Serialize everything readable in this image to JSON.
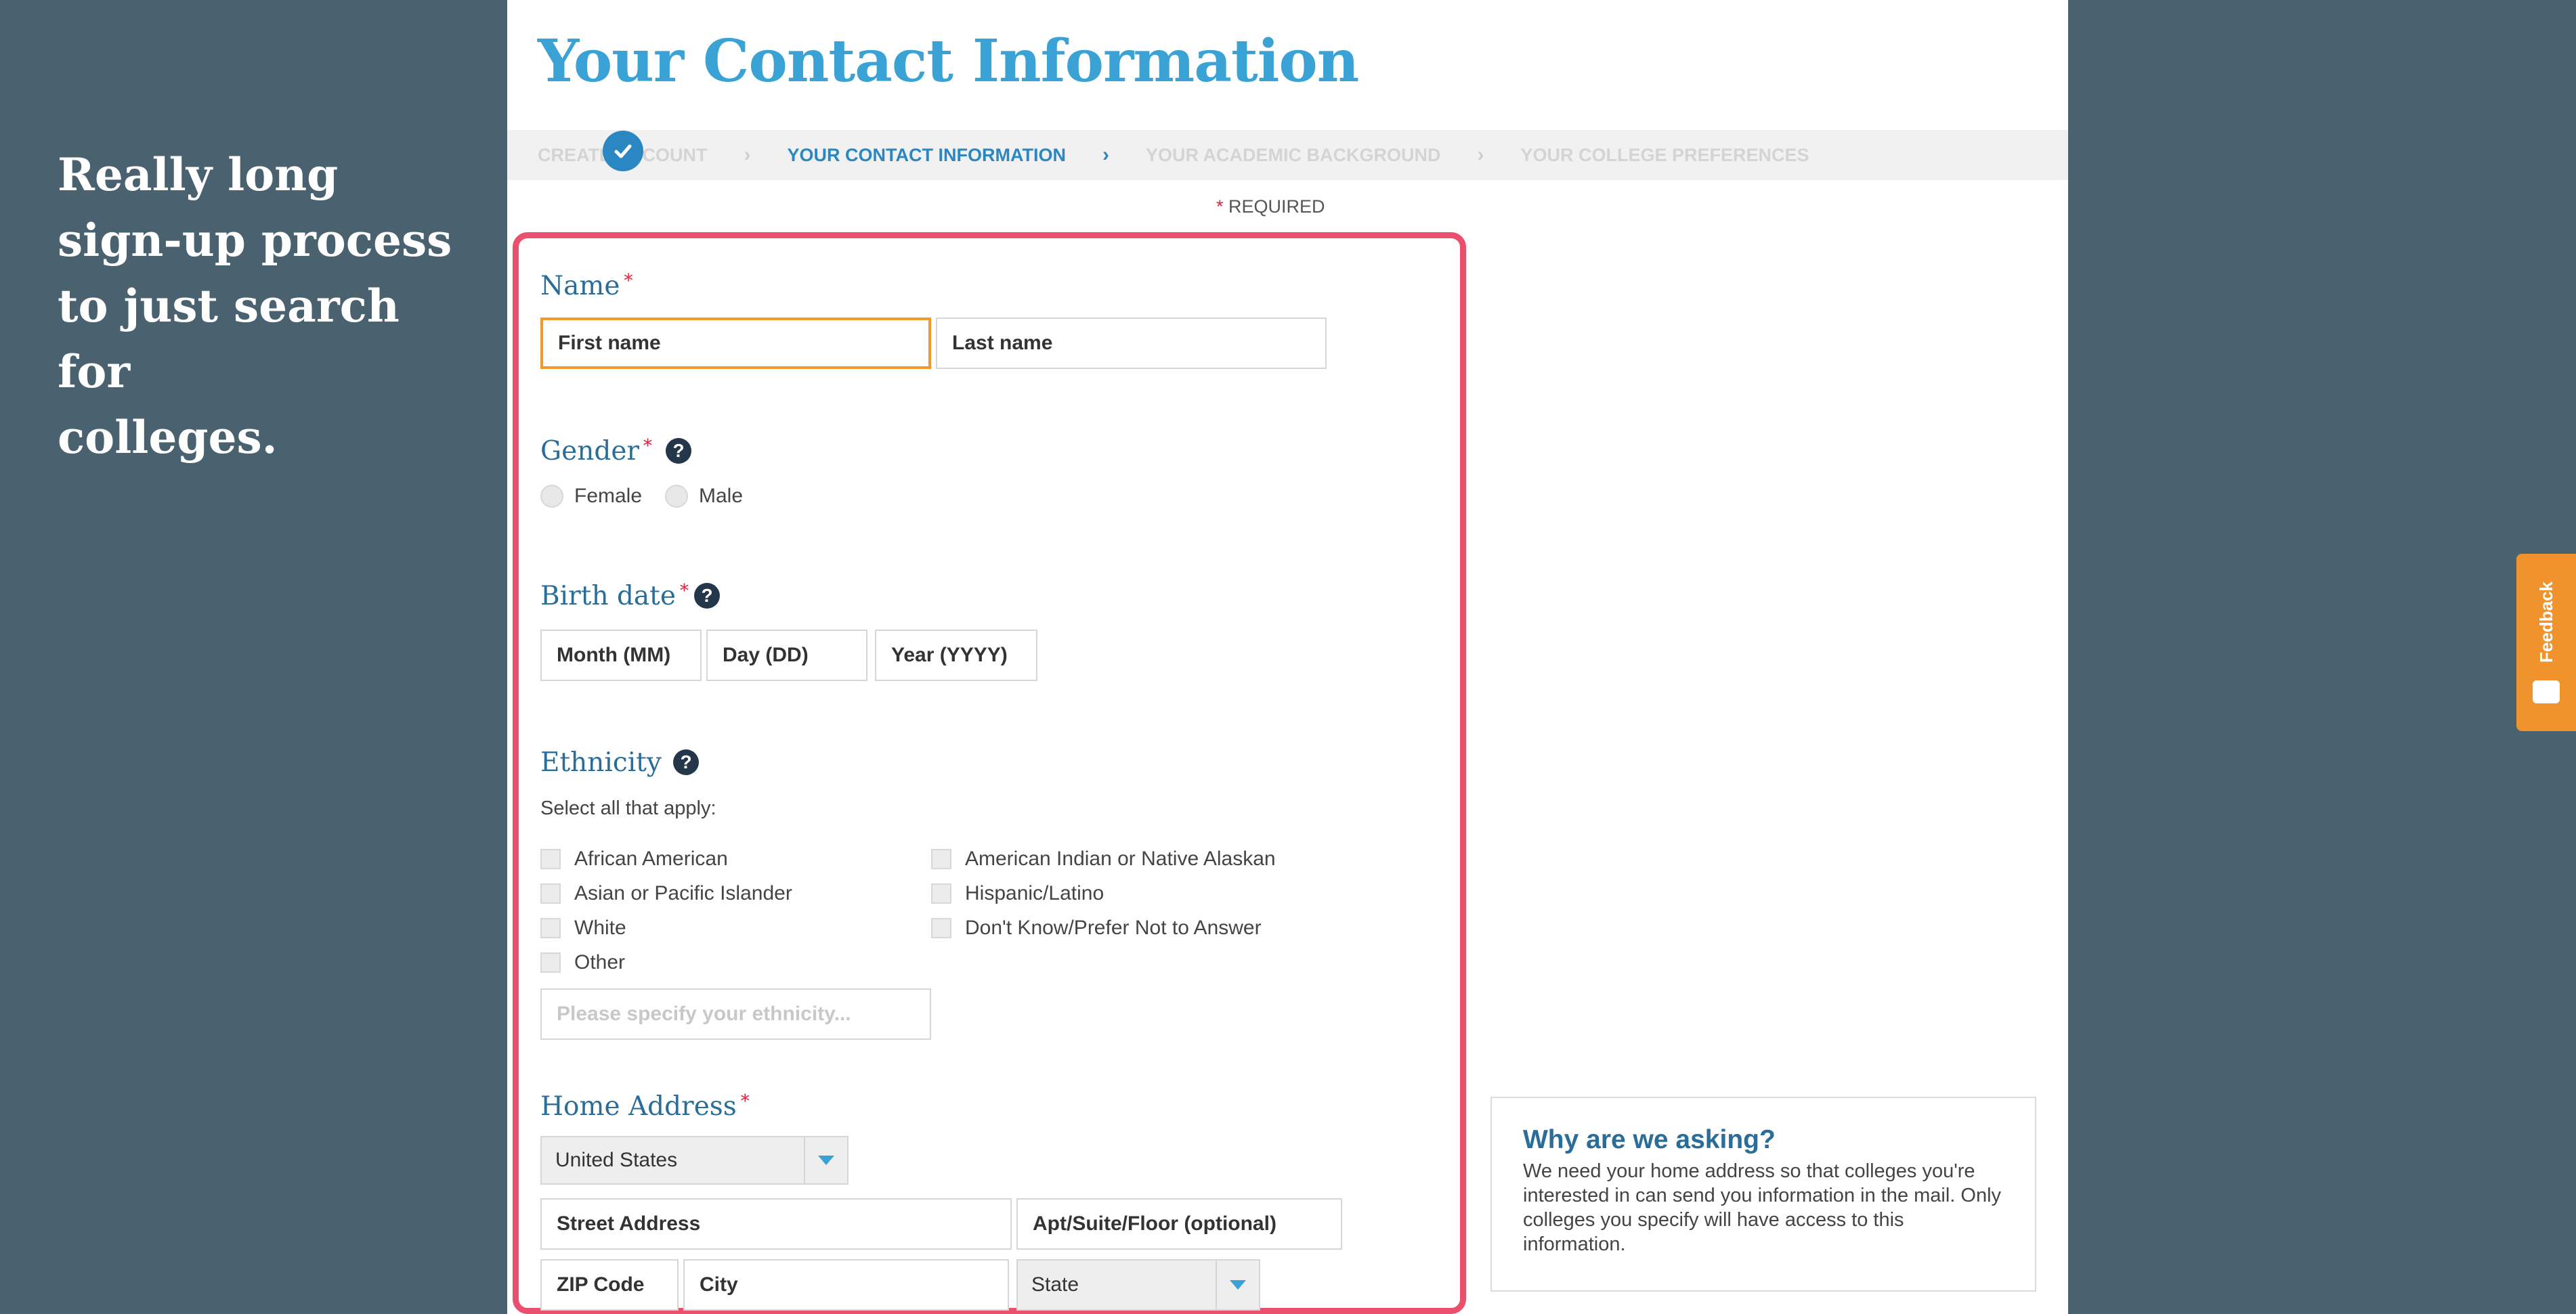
{
  "annotation": {
    "lines": [
      "Really long",
      "sign-up process",
      "to just search for",
      "colleges."
    ]
  },
  "page": {
    "title": "Your Contact Information",
    "steps": [
      {
        "label": "Create Account",
        "state": "completed"
      },
      {
        "label": "Your Contact Information",
        "state": "active"
      },
      {
        "label": "Your Academic Background",
        "state": "upcoming"
      },
      {
        "label": "Your College Preferences",
        "state": "upcoming"
      }
    ],
    "required_star": "*",
    "required_note": "REQUIRED"
  },
  "form": {
    "name": {
      "label": "Name",
      "first_placeholder": "First name",
      "last_placeholder": "Last name"
    },
    "gender": {
      "label": "Gender",
      "help": "?",
      "options": [
        "Female",
        "Male"
      ]
    },
    "birth_date": {
      "label": "Birth date",
      "help": "?",
      "month_placeholder": "Month (MM)",
      "day_placeholder": "Day (DD)",
      "year_placeholder": "Year (YYYY)"
    },
    "ethnicity": {
      "label": "Ethnicity",
      "help": "?",
      "helper": "Select all that apply:",
      "options_left": [
        "African American",
        "Asian or Pacific Islander",
        "White",
        "Other"
      ],
      "options_right": [
        "American Indian or Native Alaskan",
        "Hispanic/Latino",
        "Don't Know/Prefer Not to Answer"
      ],
      "specify_placeholder": "Please specify your ethnicity..."
    },
    "home_address": {
      "label": "Home Address",
      "country": "United States",
      "street_placeholder": "Street Address",
      "apt_placeholder": "Apt/Suite/Floor (optional)",
      "zip_placeholder": "ZIP Code",
      "city_placeholder": "City",
      "state_placeholder": "State"
    }
  },
  "why_box": {
    "title": "Why are we asking?",
    "body": "We need your home address so that colleges you're interested in can send you information in the mail. Only colleges you specify will have access to this information."
  },
  "feedback": {
    "label": "Feedback"
  },
  "colors": {
    "background": "#4a6170",
    "title_blue": "#3aa2d4",
    "label_blue": "#2a6d99",
    "active_step": "#2a87c2",
    "highlight_frame": "#ea4f6e",
    "focus_border": "#f09a2e",
    "required_star": "#e0203c",
    "feedback_tab": "#f0932c"
  }
}
